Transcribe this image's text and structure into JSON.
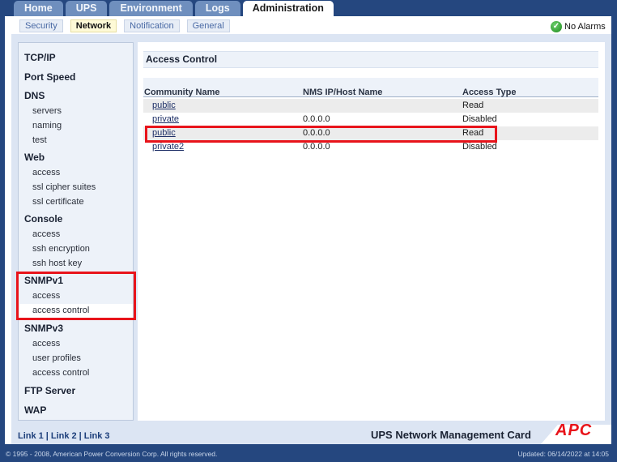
{
  "top_tabs": [
    "Home",
    "UPS",
    "Environment",
    "Logs",
    "Administration"
  ],
  "sub_tabs": [
    "Security",
    "Network",
    "Notification",
    "General"
  ],
  "alarm_status": "No Alarms",
  "sidenav": {
    "tcpip": "TCP/IP",
    "port_speed": "Port Speed",
    "dns": "DNS",
    "dns_servers": "servers",
    "dns_naming": "naming",
    "dns_test": "test",
    "web": "Web",
    "web_access": "access",
    "web_ssl_cipher": "ssl cipher suites",
    "web_ssl_cert": "ssl certificate",
    "console": "Console",
    "console_access": "access",
    "console_ssh_enc": "ssh encryption",
    "console_ssh_key": "ssh host key",
    "snmpv1": "SNMPv1",
    "snmpv1_access": "access",
    "snmpv1_access_control": "access control",
    "snmpv3": "SNMPv3",
    "snmpv3_access": "access",
    "snmpv3_user_profiles": "user profiles",
    "snmpv3_access_control": "access control",
    "ftp_server": "FTP Server",
    "wap": "WAP"
  },
  "panel": {
    "title": "Access Control",
    "columns": [
      "Community Name",
      "NMS IP/Host Name",
      "Access Type"
    ],
    "rows": [
      {
        "community": "public",
        "nms": "",
        "access": "Read"
      },
      {
        "community": "private",
        "nms": "0.0.0.0",
        "access": "Disabled"
      },
      {
        "community": "public",
        "nms": "0.0.0.0",
        "access": "Read"
      },
      {
        "community": "private2",
        "nms": "0.0.0.0",
        "access": "Disabled"
      }
    ]
  },
  "footer": {
    "link1": "Link 1",
    "link2": "Link 2",
    "link3": "Link 3",
    "product": "UPS Network Management Card",
    "brand": "APC",
    "copyright": "© 1995 - 2008, American Power Conversion Corp. All rights reserved.",
    "updated": "Updated: 06/14/2022 at 14:05"
  },
  "colors": {
    "background": "#25477f",
    "highlight": "#e8141b",
    "active_subtab": "#fefad7"
  }
}
